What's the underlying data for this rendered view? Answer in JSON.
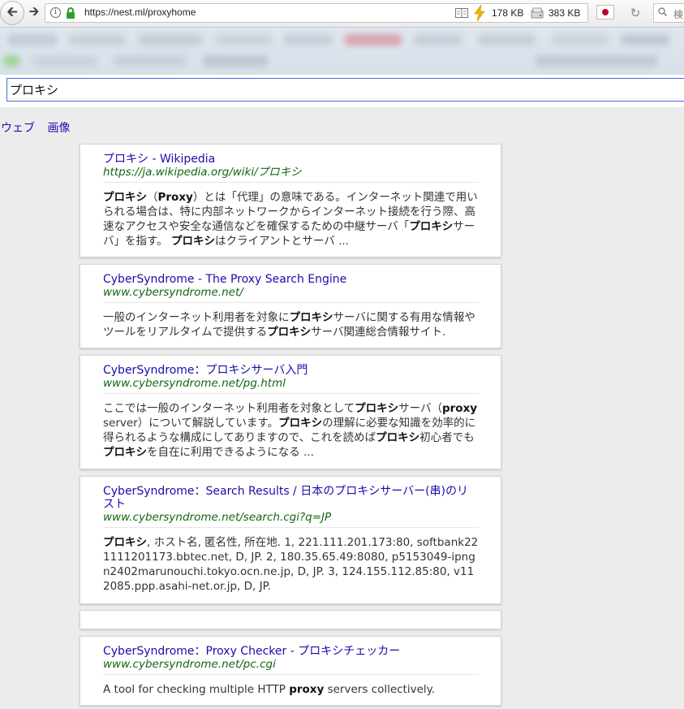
{
  "browser": {
    "url": "https://nest.ml/proxyhome",
    "download_size": "178 KB",
    "cache_size": "383 KB",
    "search_placeholder": "検",
    "colors": {
      "flag_red": "#bc002d",
      "bolt": "#f4b400"
    }
  },
  "search": {
    "query": "プロキシ"
  },
  "tabs": [
    "ウェブ",
    "画像"
  ],
  "results": [
    {
      "title": "プロキシ - Wikipedia",
      "url": "https://ja.wikipedia.org/wiki/プロキシ",
      "snippet": [
        {
          "t": "プロキシ",
          "b": true
        },
        {
          "t": "（"
        },
        {
          "t": "Proxy",
          "b": true
        },
        {
          "t": "）とは「代理」の意味である。インターネット関連で用いられる場合は、特に内部ネットワークからインターネット接続を行う際、高速なアクセスや安全な通信などを確保するための中継サーバ「"
        },
        {
          "t": "プロキシ",
          "b": true
        },
        {
          "t": "サーバ」を指す。 "
        },
        {
          "t": "プロキシ",
          "b": true
        },
        {
          "t": "はクライアントとサーバ ..."
        }
      ]
    },
    {
      "title": "CyberSyndrome - The Proxy Search Engine",
      "url": "www.cybersyndrome.net/",
      "snippet": [
        {
          "t": "一般のインターネット利用者を対象に"
        },
        {
          "t": "プロキシ",
          "b": true
        },
        {
          "t": "サーバに関する有用な情報やツールをリアルタイムで提供する"
        },
        {
          "t": "プロキシ",
          "b": true
        },
        {
          "t": "サーバ関連総合情報サイト."
        }
      ]
    },
    {
      "title": "CyberSyndrome：プロキシサーバ入門",
      "url": "www.cybersyndrome.net/pg.html",
      "snippet": [
        {
          "t": "ここでは一般のインターネット利用者を対象として"
        },
        {
          "t": "プロキシ",
          "b": true
        },
        {
          "t": "サーバ（"
        },
        {
          "t": "proxy",
          "b": true
        },
        {
          "t": " server）について解説しています。"
        },
        {
          "t": "プロキシ",
          "b": true
        },
        {
          "t": "の理解に必要な知識を効率的に得られるような構成にしてありますので、これを読めば"
        },
        {
          "t": "プロキシ",
          "b": true
        },
        {
          "t": "初心者でも"
        },
        {
          "t": "プロキシ",
          "b": true
        },
        {
          "t": "を自在に利用できるようになる ..."
        }
      ]
    },
    {
      "title": "CyberSyndrome：Search Results / 日本のプロキシサーバー(串)のリスト",
      "url": "www.cybersyndrome.net/search.cgi?q=JP",
      "snippet": [
        {
          "t": "プロキシ",
          "b": true
        },
        {
          "t": ", ホスト名, 匿名性, 所在地. 1, 221.111.201.173:80, softbank221111201173.bbtec.net, D, JP. 2, 180.35.65.49:8080, p5153049-ipngn2402marunouchi.tokyo.ocn.ne.jp, D, JP. 3, 124.155.112.85:80, v112085.ppp.asahi-net.or.jp, D, JP."
        }
      ]
    },
    {
      "empty": true
    },
    {
      "title": "CyberSyndrome：Proxy Checker - プロキシチェッカー",
      "url": "www.cybersyndrome.net/pc.cgi",
      "snippet": [
        {
          "t": "A tool for checking multiple HTTP "
        },
        {
          "t": "proxy",
          "b": true
        },
        {
          "t": " servers collectively."
        }
      ]
    }
  ]
}
